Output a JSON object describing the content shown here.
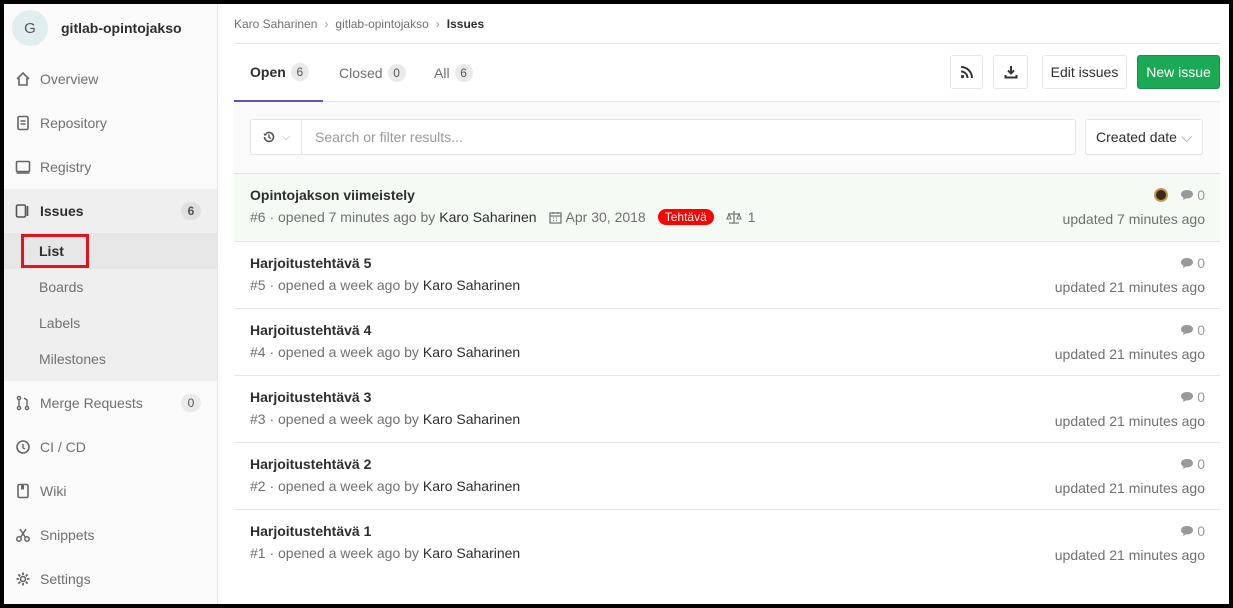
{
  "project": {
    "avatar_letter": "G",
    "name": "gitlab-opintojakso"
  },
  "sidebar": {
    "items": [
      {
        "label": "Overview",
        "icon": "home-icon"
      },
      {
        "label": "Repository",
        "icon": "doc-icon"
      },
      {
        "label": "Registry",
        "icon": "container-icon"
      },
      {
        "label": "Issues",
        "icon": "issues-icon",
        "count": "6"
      },
      {
        "label": "Merge Requests",
        "icon": "merge-icon",
        "count": "0"
      },
      {
        "label": "CI / CD",
        "icon": "rocket-icon"
      },
      {
        "label": "Wiki",
        "icon": "book-icon"
      },
      {
        "label": "Snippets",
        "icon": "scissors-icon"
      },
      {
        "label": "Settings",
        "icon": "gear-icon"
      }
    ],
    "issues_sub": [
      "List",
      "Boards",
      "Labels",
      "Milestones"
    ]
  },
  "breadcrumb": {
    "user": "Karo Saharinen",
    "project": "gitlab-opintojakso",
    "current": "Issues"
  },
  "tabs": [
    {
      "label": "Open",
      "count": "6"
    },
    {
      "label": "Closed",
      "count": "0"
    },
    {
      "label": "All",
      "count": "6"
    }
  ],
  "actions": {
    "edit": "Edit issues",
    "new": "New issue"
  },
  "filter": {
    "placeholder": "Search or filter results...",
    "sort": "Created date"
  },
  "issues": [
    {
      "title": "Opintojakson viimeistely",
      "ref": "#6 · opened 7 minutes ago by",
      "author": "Karo Saharinen",
      "due": "Apr 30, 2018",
      "label": "Tehtävä",
      "weight": "1",
      "comments": "0",
      "updated": "updated 7 minutes ago"
    },
    {
      "title": "Harjoitustehtävä 5",
      "ref": "#5 · opened a week ago by",
      "author": "Karo Saharinen",
      "comments": "0",
      "updated": "updated 21 minutes ago"
    },
    {
      "title": "Harjoitustehtävä 4",
      "ref": "#4 · opened a week ago by",
      "author": "Karo Saharinen",
      "comments": "0",
      "updated": "updated 21 minutes ago"
    },
    {
      "title": "Harjoitustehtävä 3",
      "ref": "#3 · opened a week ago by",
      "author": "Karo Saharinen",
      "comments": "0",
      "updated": "updated 21 minutes ago"
    },
    {
      "title": "Harjoitustehtävä 2",
      "ref": "#2 · opened a week ago by",
      "author": "Karo Saharinen",
      "comments": "0",
      "updated": "updated 21 minutes ago"
    },
    {
      "title": "Harjoitustehtävä 1",
      "ref": "#1 · opened a week ago by",
      "author": "Karo Saharinen",
      "comments": "0",
      "updated": "updated 21 minutes ago"
    }
  ],
  "colors": {
    "label_bg": "#ff0000",
    "primary": "#1aaa55",
    "tab_active": "#6b4fbb",
    "highlight": "#e0141e"
  }
}
